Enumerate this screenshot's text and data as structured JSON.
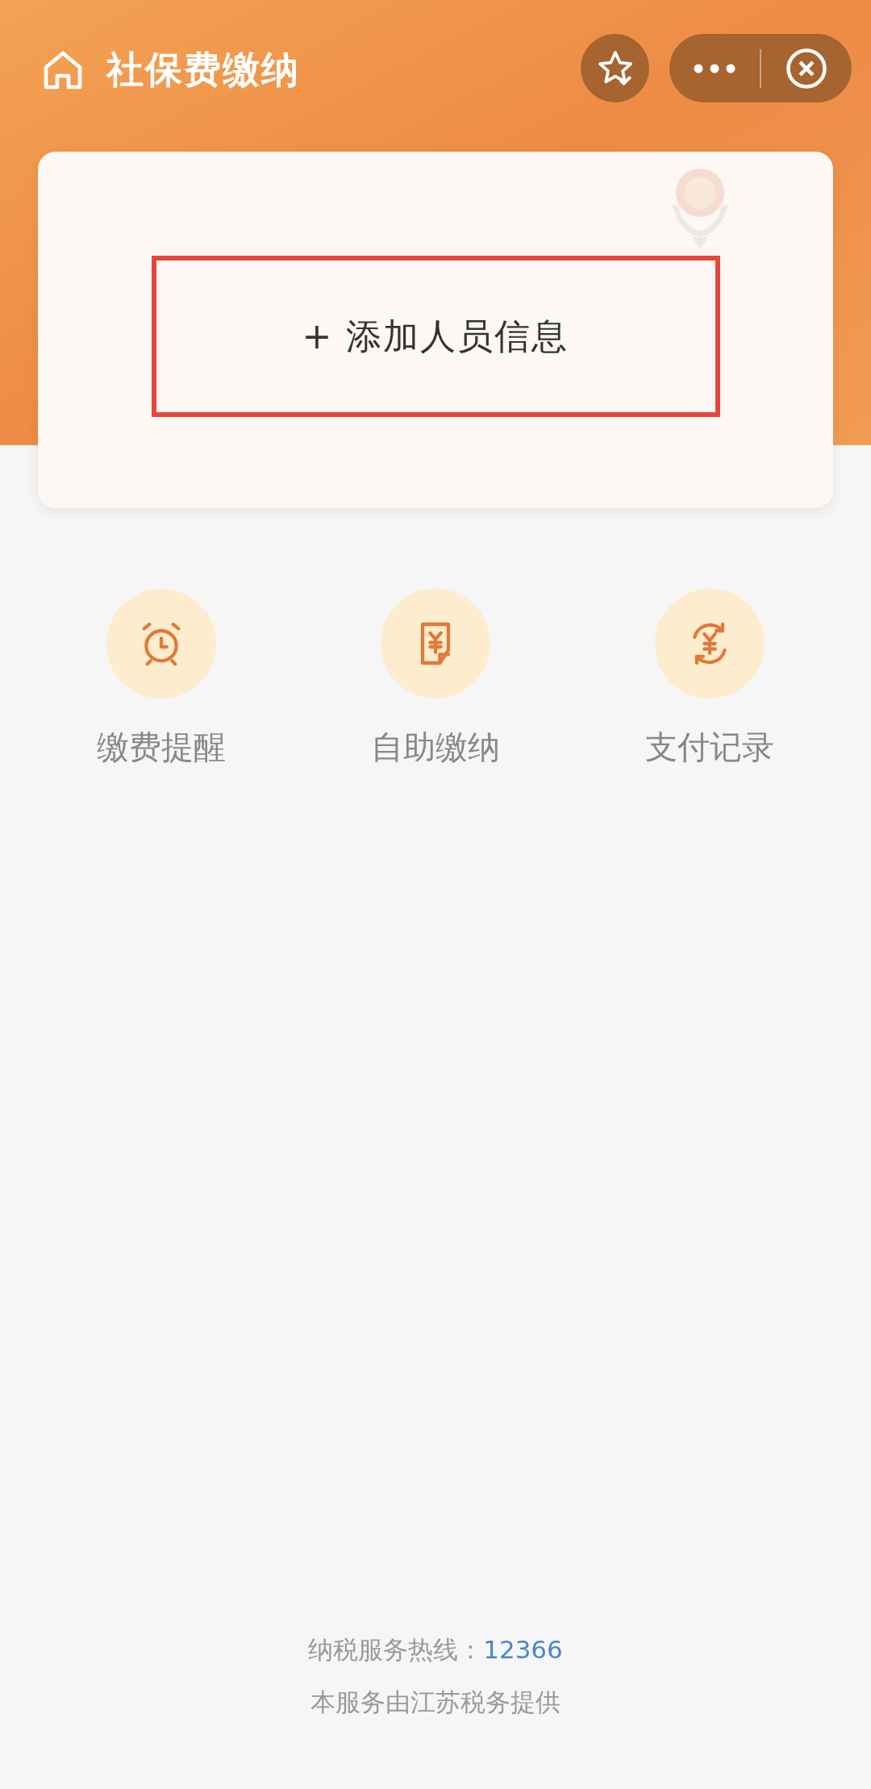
{
  "header": {
    "title": "社保费缴纳"
  },
  "add_button": {
    "label": "+ 添加人员信息",
    "highlighted": true
  },
  "shortcuts": [
    {
      "kind": "alarm",
      "label": "缴费提醒"
    },
    {
      "kind": "bill",
      "label": "自助缴纳"
    },
    {
      "kind": "exchange",
      "label": "支付记录"
    }
  ],
  "footer": {
    "hotline_label": "纳税服务热线：",
    "hotline_number": "12366",
    "provider": "本服务由江苏税务提供"
  }
}
